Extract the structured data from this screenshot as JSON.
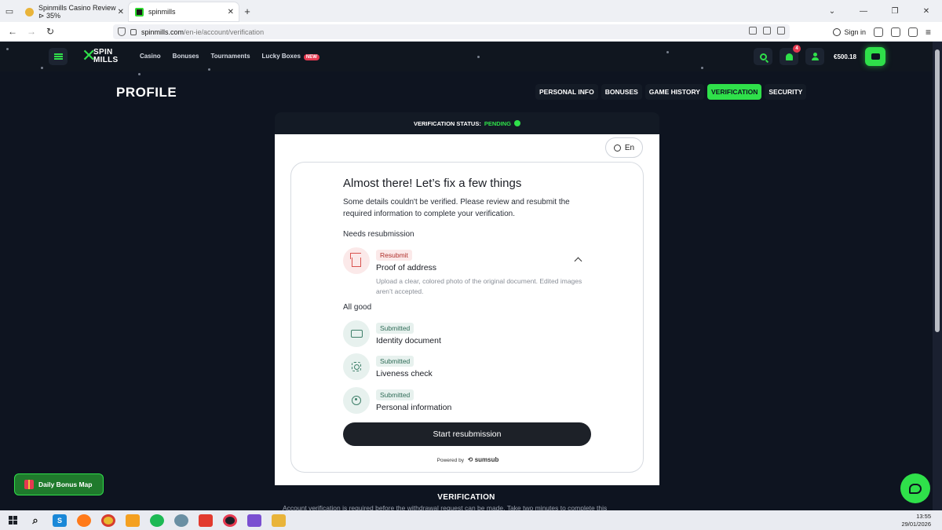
{
  "browser": {
    "tabs": [
      {
        "title": "Spinmills Casino Review ⊳ 35%"
      },
      {
        "title": "spinmills"
      }
    ],
    "url_host": "spinmills.com",
    "url_path": "/en-ie/account/verification",
    "sign_in": "Sign in"
  },
  "site": {
    "logo_line1": "SPIN",
    "logo_line2": "MILLS",
    "nav": [
      "Casino",
      "Bonuses",
      "Tournaments",
      "Lucky Boxes"
    ],
    "new_badge": "NEW",
    "notification_count": "4",
    "balance": "€500.18",
    "colors": {
      "accent": "#2fe04a",
      "background": "#0e1420",
      "danger": "#e53950"
    }
  },
  "profile": {
    "title": "PROFILE",
    "tabs": [
      "PERSONAL INFO",
      "BONUSES",
      "GAME HISTORY",
      "VERIFICATION",
      "SECURITY"
    ],
    "active_tab": "VERIFICATION"
  },
  "verification": {
    "status_label": "VERIFICATION STATUS:",
    "status_value": "PENDING",
    "lang": "En",
    "title": "Almost there! Let’s fix a few things",
    "description": "Some details couldn't be verified. Please review and resubmit the required information to complete your verification.",
    "needs_label": "Needs resubmission",
    "resubmit_item": {
      "badge": "Resubmit",
      "name": "Proof of address",
      "note": "Upload a clear, colored photo of the original document. Edited images aren’t accepted."
    },
    "good_label": "All good",
    "good_items": [
      {
        "badge": "Submitted",
        "name": "Identity document"
      },
      {
        "badge": "Submitted",
        "name": "Liveness check"
      },
      {
        "badge": "Submitted",
        "name": "Personal information"
      }
    ],
    "cta": "Start resubmission",
    "powered_by": "Powered by",
    "powered_brand": "sumsub"
  },
  "footer": {
    "bonus_map": "Daily Bonus Map",
    "heading": "VERIFICATION",
    "text": "Account verification is required before the withdrawal request can be made. Take two minutes to complete this"
  },
  "taskbar": {
    "time": "13:55",
    "date": "29/01/2026"
  }
}
